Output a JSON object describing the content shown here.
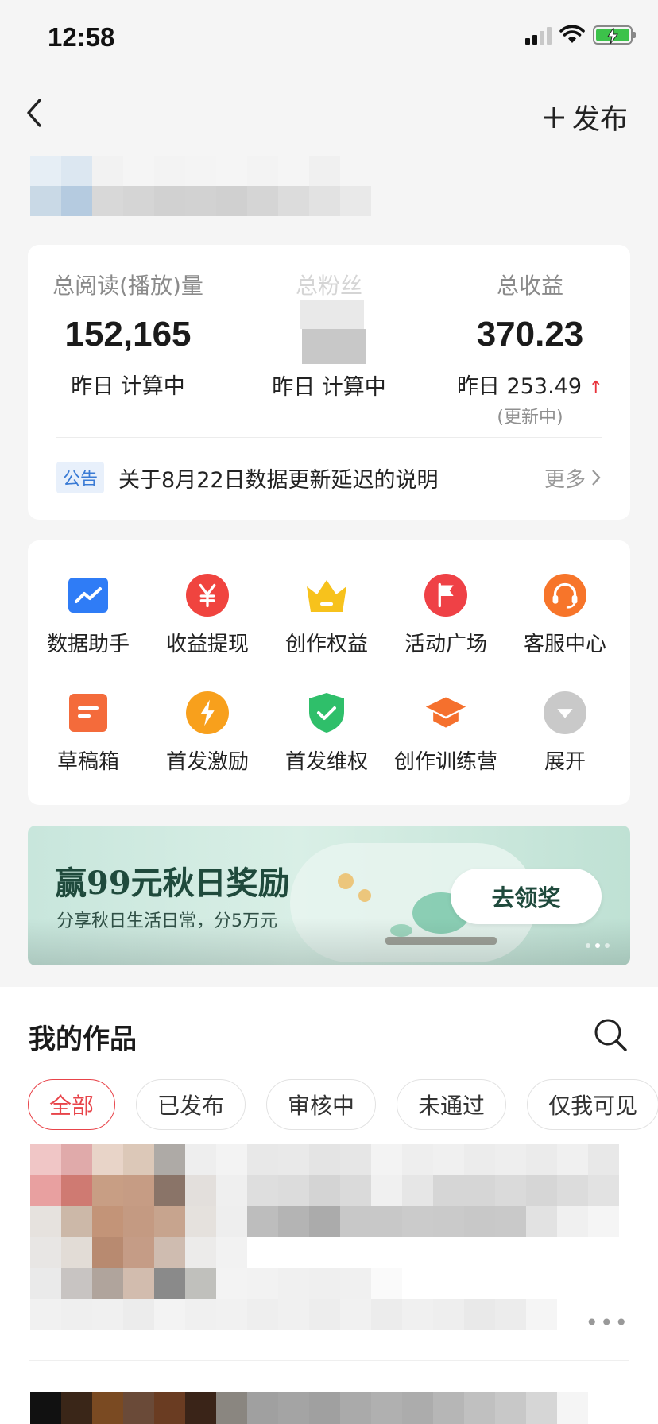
{
  "status_bar": {
    "time": "12:58"
  },
  "nav": {
    "publish_label": "发布"
  },
  "stats": {
    "reads": {
      "label": "总阅读(播放)量",
      "value": "152,165",
      "sub": "昨日 计算中"
    },
    "fans": {
      "label": "总粉丝",
      "sub": "昨日 计算中"
    },
    "income": {
      "label": "总收益",
      "value": "370.23",
      "sub_prefix": "昨日",
      "sub_value": "253.49",
      "note": "(更新中)"
    }
  },
  "notice": {
    "tag": "公告",
    "text": "关于8月22日数据更新延迟的说明",
    "more": "更多"
  },
  "tools": [
    {
      "label": "数据助手",
      "icon": "chart-icon",
      "color": "#2f7cf6"
    },
    {
      "label": "收益提现",
      "icon": "yuan-icon",
      "color": "#f0443f"
    },
    {
      "label": "创作权益",
      "icon": "crown-icon",
      "color": "#f7c21c"
    },
    {
      "label": "活动广场",
      "icon": "flag-icon",
      "color": "#ef4146"
    },
    {
      "label": "客服中心",
      "icon": "headset-icon",
      "color": "#f7752a"
    },
    {
      "label": "草稿箱",
      "icon": "draft-icon",
      "color": "#f46b3b"
    },
    {
      "label": "首发激励",
      "icon": "lightning-icon",
      "color": "#f8a01c"
    },
    {
      "label": "首发维权",
      "icon": "shield-check-icon",
      "color": "#2fbf6a"
    },
    {
      "label": "创作训练营",
      "icon": "graduation-cap-icon",
      "color": "#f5702d"
    },
    {
      "label": "展开",
      "icon": "expand-icon",
      "color": "#c9c9c9"
    }
  ],
  "banner": {
    "title": "赢99元秋日奖励",
    "subtitle": "分享秋日生活日常，分5万元",
    "button": "去领奖"
  },
  "works": {
    "title": "我的作品",
    "filters": [
      "全部",
      "已发布",
      "审核中",
      "未通过",
      "仅我可见"
    ],
    "active_filter": "全部"
  }
}
